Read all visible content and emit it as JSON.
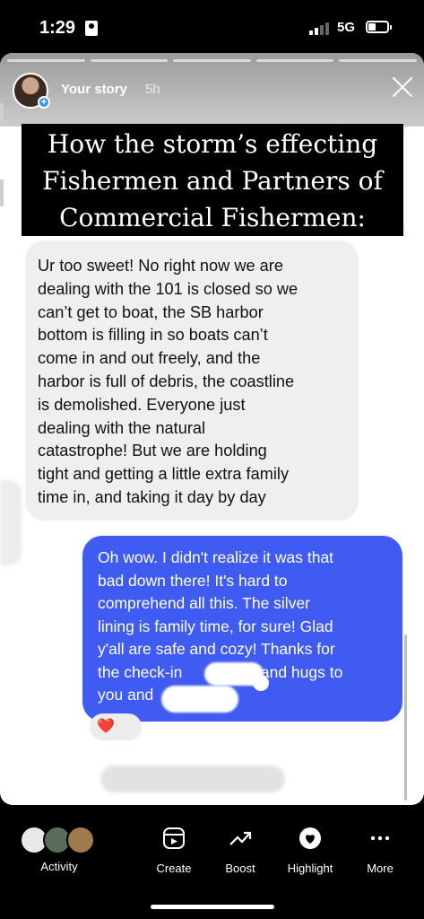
{
  "status_bar": {
    "time": "1:29",
    "network": "5G"
  },
  "story": {
    "owner": "Your story",
    "age": "5h",
    "headline": [
      "How the storm’s effecting",
      "Fishermen and Partners of",
      "Commercial Fishermen:"
    ],
    "incoming_message": [
      "Ur too sweet! No right now we are",
      "dealing with the 101 is closed so we",
      "can’t get to boat, the SB harbor",
      "bottom is filling in so boats can’t",
      "come in and out freely, and the",
      "harbor is full of debris, the coastline",
      "is demolished. Everyone just",
      "dealing with the natural",
      "catastrophe! But we are holding",
      "tight and getting a little extra family",
      "time in, and taking it day by day"
    ],
    "outgoing_message": [
      "Oh wow. I didn't realize it was that",
      "bad down there! It's hard to",
      "comprehend all this. The silver",
      "lining is family time, for sure! Glad",
      "y'all are safe and cozy! Thanks for",
      "the check-in                  and hugs to",
      "you and"
    ],
    "reaction": "❤️"
  },
  "bottom_nav": {
    "activity": "Activity",
    "create": "Create",
    "boost": "Boost",
    "highlight": "Highlight",
    "more": "More"
  },
  "colors": {
    "outgoing_bubble": "#3f5bf2",
    "incoming_bubble": "#efefef"
  },
  "icons": [
    "id-card-icon",
    "signal-icon",
    "battery-icon",
    "close-icon",
    "create-icon",
    "boost-icon",
    "highlight-icon",
    "more-icon"
  ]
}
